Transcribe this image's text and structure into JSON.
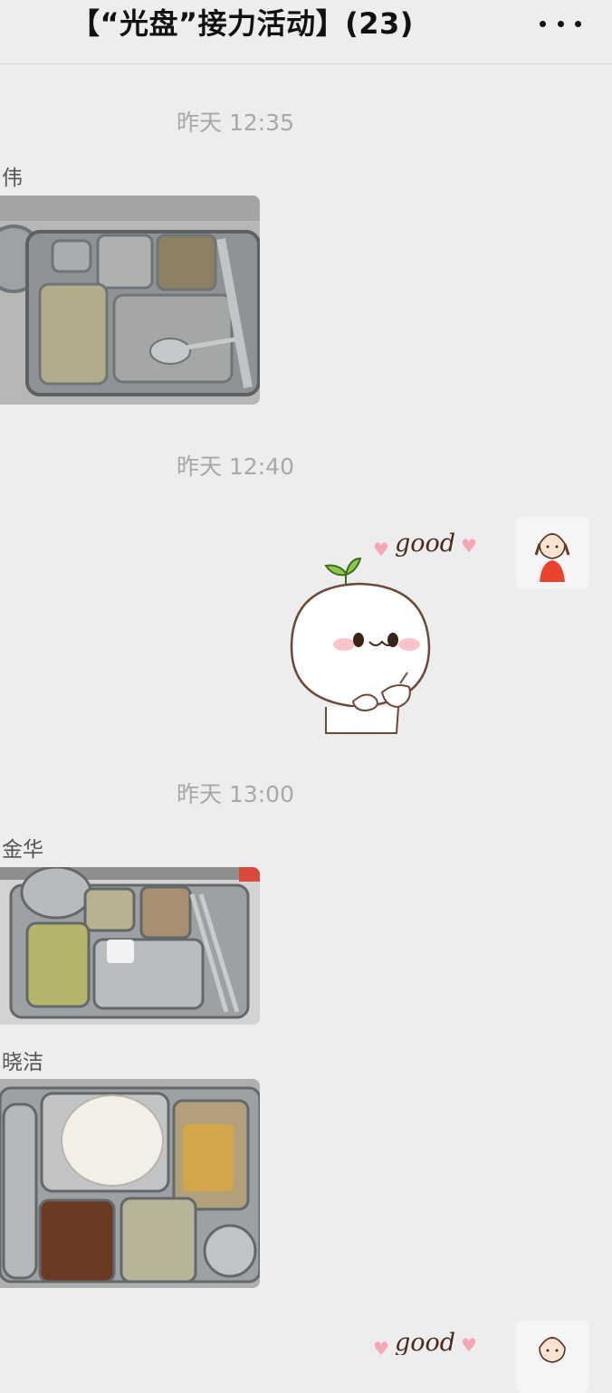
{
  "header": {
    "title": "【“光盘”接力活动】(23)",
    "more_icon": "more-dots-icon"
  },
  "messages": [
    {
      "type": "timestamp",
      "text": "昨天 12:35"
    },
    {
      "type": "photo",
      "sender": "伟",
      "content": "empty-tray-photo"
    },
    {
      "type": "timestamp",
      "text": "昨天 12:40"
    },
    {
      "type": "sticker",
      "self": true,
      "text": "good"
    },
    {
      "type": "timestamp",
      "text": "昨天 13:00"
    },
    {
      "type": "photo",
      "sender": "金华",
      "content": "empty-tray-photo"
    },
    {
      "type": "photo",
      "sender": "晓洁",
      "content": "empty-tray-photo"
    },
    {
      "type": "sticker",
      "self": true,
      "text": "good"
    }
  ],
  "colors": {
    "background": "#ededed",
    "timestamp": "#a8a8a8",
    "tray": "#8f9396",
    "sticker_outline": "#6b4a3a",
    "heart": "#f2a9b4"
  }
}
